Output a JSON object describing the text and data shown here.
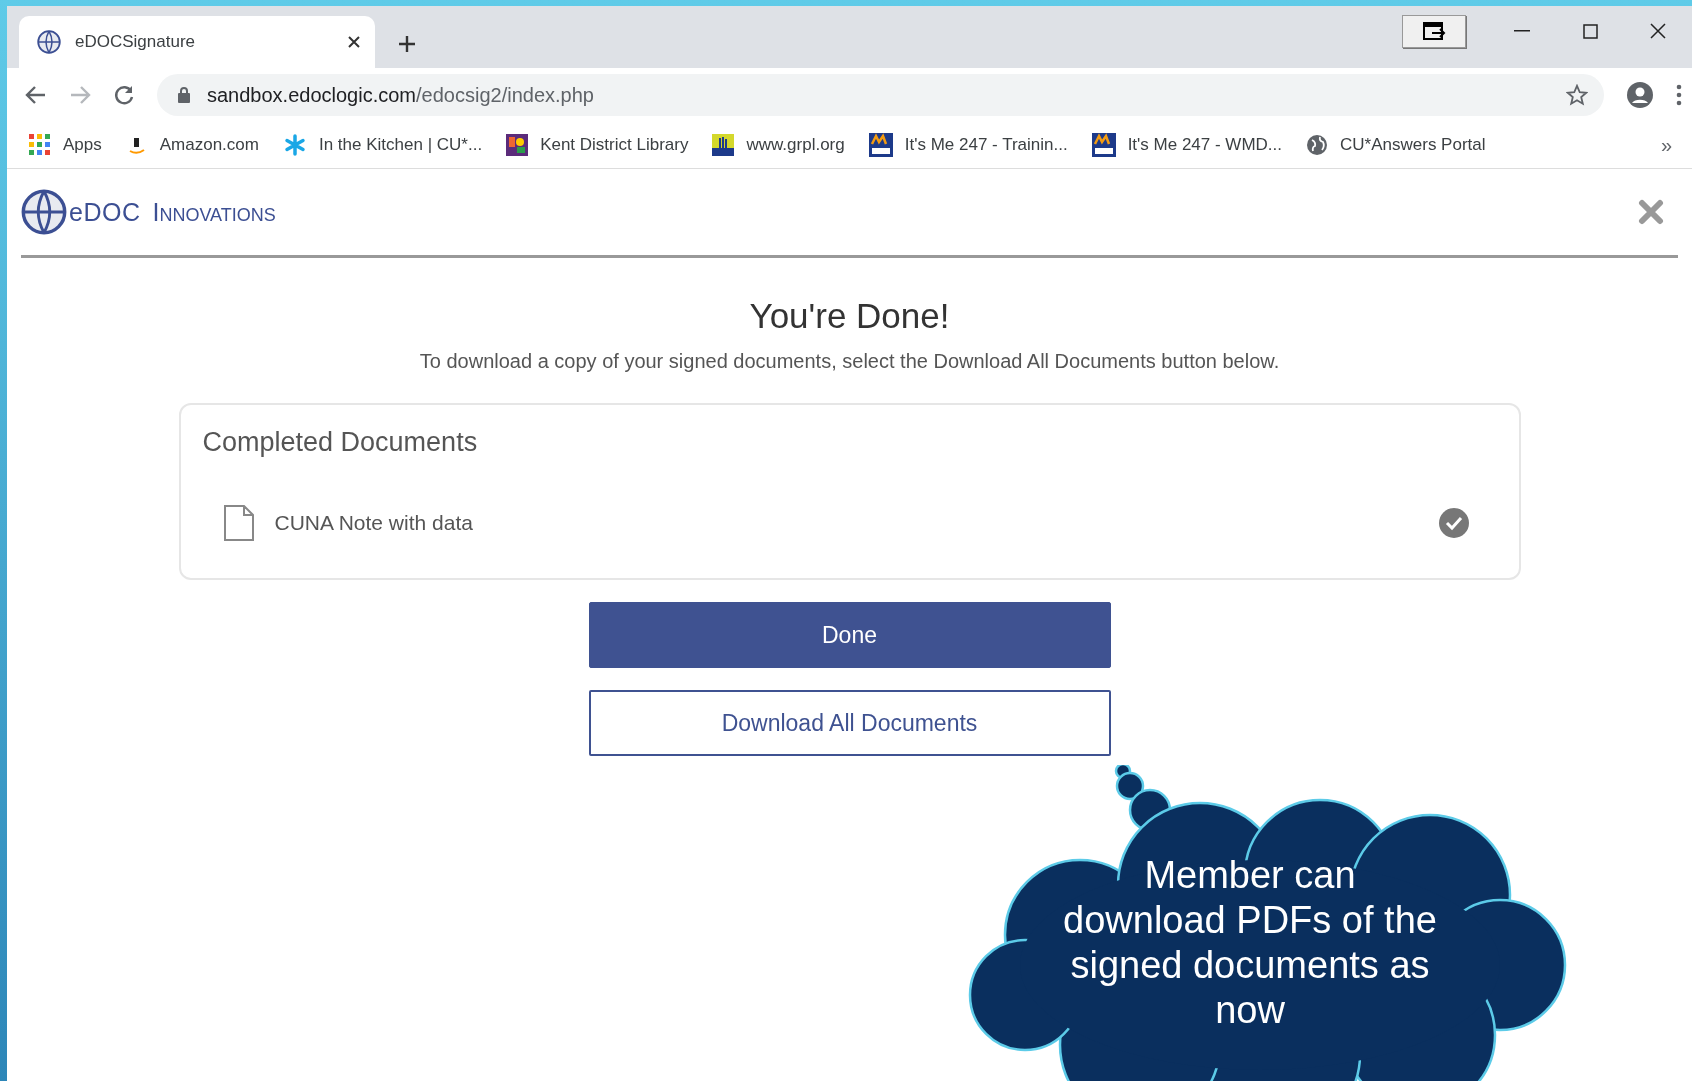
{
  "browser": {
    "tab": {
      "title": "eDOCSignature",
      "selected": true
    },
    "url": {
      "host": "sandbox.edoclogic.com",
      "path": "/edocsig2/index.php"
    },
    "bookmarks": [
      {
        "label": "Apps"
      },
      {
        "label": "Amazon.com"
      },
      {
        "label": "In the Kitchen | CU*..."
      },
      {
        "label": "Kent District Library"
      },
      {
        "label": "www.grpl.org"
      },
      {
        "label": "It's Me 247 - Trainin..."
      },
      {
        "label": "It's Me 247 - WMD..."
      },
      {
        "label": "CU*Answers Portal"
      }
    ],
    "overflow": "»"
  },
  "header": {
    "logo_main": "eDOC",
    "logo_sub": "Innovations"
  },
  "heading": "You're Done!",
  "instructions": "To download a copy of your signed documents, select the Download All Documents button below.",
  "card": {
    "title": "Completed Documents",
    "documents": [
      {
        "name": "CUNA Note with data",
        "completed": true
      }
    ]
  },
  "buttons": [
    {
      "label": "Done",
      "kind": "primary"
    },
    {
      "label": "Download All Documents",
      "kind": "outline"
    }
  ],
  "callout": {
    "text": "Member can download PDFs of the signed documents as now"
  }
}
